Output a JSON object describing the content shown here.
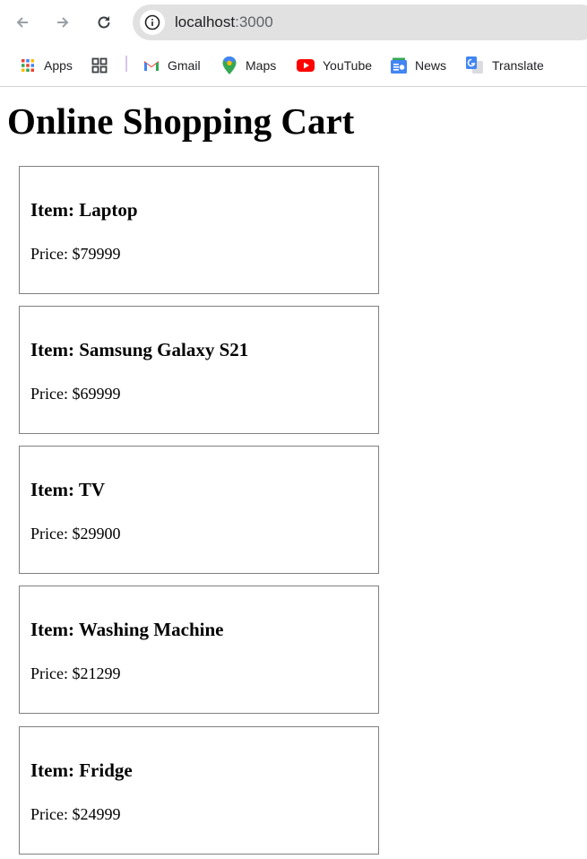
{
  "browser": {
    "url_host": "localhost",
    "url_port": ":3000",
    "bookmarks": [
      {
        "label": "Apps",
        "icon": "apps-grid-icon"
      },
      {
        "label": "",
        "icon": "tab-groups-icon"
      },
      {
        "label": "Gmail",
        "icon": "gmail-icon"
      },
      {
        "label": "Maps",
        "icon": "maps-icon"
      },
      {
        "label": "YouTube",
        "icon": "youtube-icon"
      },
      {
        "label": "News",
        "icon": "news-icon"
      },
      {
        "label": "Translate",
        "icon": "translate-icon"
      }
    ]
  },
  "page": {
    "title": "Online Shopping Cart",
    "items": [
      {
        "name": "Item: Laptop",
        "price": "Price: $79999"
      },
      {
        "name": "Item: Samsung Galaxy S21",
        "price": "Price: $69999"
      },
      {
        "name": "Item: TV",
        "price": "Price: $29900"
      },
      {
        "name": "Item: Washing Machine",
        "price": "Price: $21299"
      },
      {
        "name": "Item: Fridge",
        "price": "Price: $24999"
      }
    ]
  },
  "colors": {
    "omnibox_bg": "#e1e1e1",
    "card_border": "#808080",
    "youtube_red": "#ff0000",
    "gmail_red": "#ea4335"
  }
}
